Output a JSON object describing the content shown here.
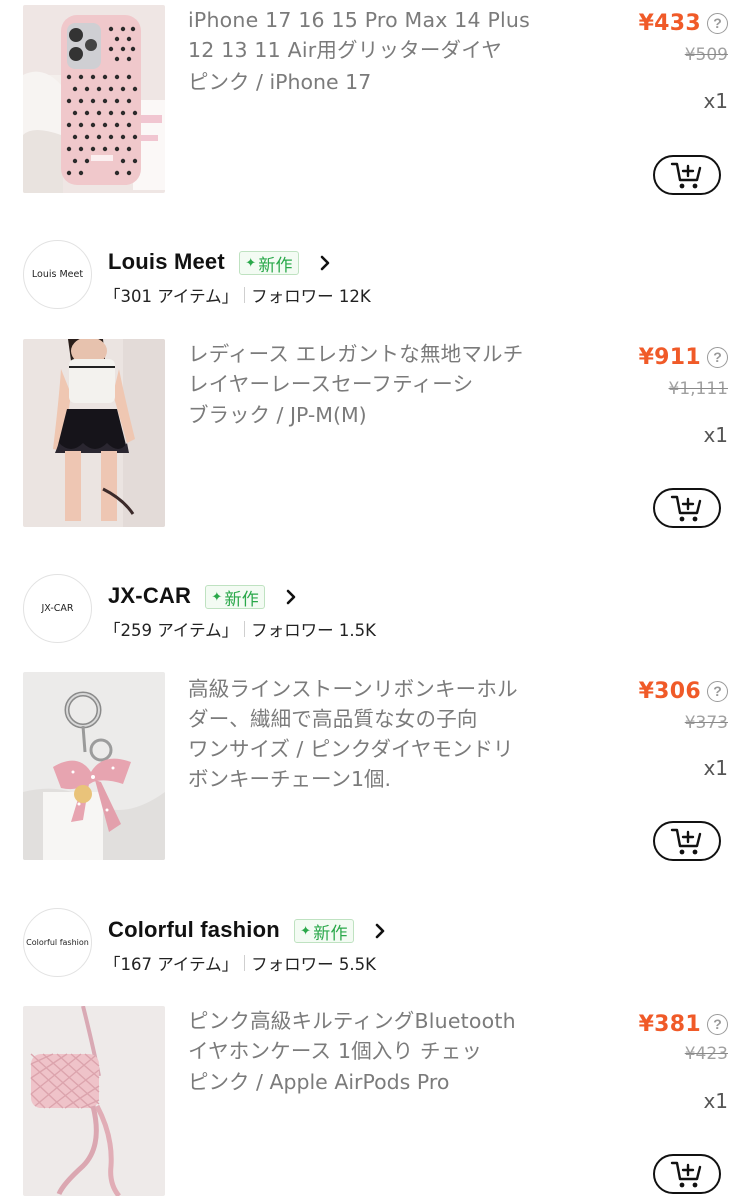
{
  "products": [
    {
      "title": "iPhone 17 16 15 Pro Max 14 Plus 12 13 11 Air用グリッターダイヤ",
      "variant": "ピンク / iPhone 17",
      "price": "¥433",
      "original_price": "¥509",
      "quantity": "x1",
      "image_icon": "pink-polka-dot-phone-case"
    },
    {
      "title": "レディース エレガントな無地マルチレイヤーレースセーフティーシ",
      "variant": "ブラック / JP-M(M)",
      "price": "¥911",
      "original_price": "¥1,111",
      "quantity": "x1",
      "image_icon": "white-top-black-lace-shorts"
    },
    {
      "title": "高級ラインストーンリボンキーホルダー、繊細で高品質な女の子向",
      "variant": "ワンサイズ / ピンクダイヤモンドリボンキーチェーン1個.",
      "price": "¥306",
      "original_price": "¥373",
      "quantity": "x1",
      "image_icon": "pink-ribbon-keychain"
    },
    {
      "title": "ピンク高級キルティングBluetoothイヤホンケース 1個入り チェッ",
      "variant": "ピンク / Apple AirPods Pro",
      "price": "¥381",
      "original_price": "¥423",
      "quantity": "x1",
      "image_icon": "pink-quilted-airpods-case"
    }
  ],
  "stores": [
    {
      "logo_text": "Louis Meet",
      "name": "Louis Meet",
      "badge": "新作",
      "items": "「301 アイテム」",
      "followers": "フォロワー 12K"
    },
    {
      "logo_text": "JX-CAR",
      "name": "JX-CAR",
      "badge": "新作",
      "items": "「259 アイテム」",
      "followers": "フォロワー 1.5K"
    },
    {
      "logo_text": "Colorful fashion",
      "name": "Colorful fashion",
      "badge": "新作",
      "items": "「167 アイテム」",
      "followers": "フォロワー 5.5K"
    }
  ],
  "colors": {
    "price": "#f05a28",
    "badge_green": "#2aa84a",
    "muted_text": "#7b7b7b"
  },
  "icons": {
    "help": "question-circle-icon",
    "cart": "add-to-cart-icon",
    "chevron": "chevron-right-icon",
    "sparkle": "sparkle-icon"
  }
}
